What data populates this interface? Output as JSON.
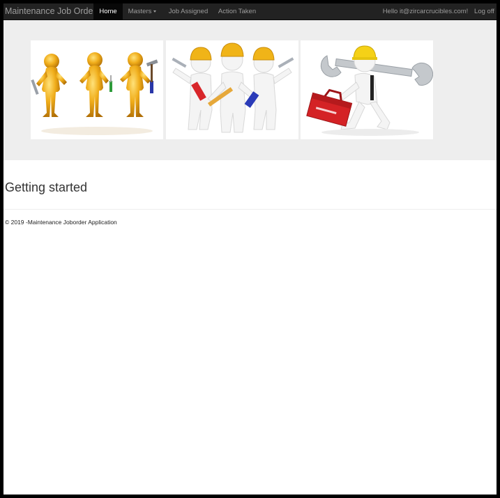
{
  "navbar": {
    "brand": "Maintenance Job Order",
    "items": [
      {
        "label": "Home",
        "active": true
      },
      {
        "label": "Masters",
        "dropdown": true
      },
      {
        "label": "Job Assigned"
      },
      {
        "label": "Action Taken"
      }
    ],
    "greeting": "Hello it@zircarcrucibles.com!",
    "logoff": "Log off"
  },
  "banner": {
    "images": [
      {
        "subject": "three-gold-workers-with-tools-image"
      },
      {
        "subject": "three-white-workers-with-hardhats-image"
      },
      {
        "subject": "worker-with-wrench-and-toolbox-image"
      }
    ]
  },
  "main": {
    "heading": "Getting started"
  },
  "footer": {
    "text": "© 2019 -Maintenance Joborder Application"
  },
  "colors": {
    "navbar_bg": "#222222",
    "active_tab_bg": "#080808",
    "jumbotron_bg": "#eeeeee",
    "hardhat": "#f0b418",
    "gold_figure": "#e8a416"
  }
}
